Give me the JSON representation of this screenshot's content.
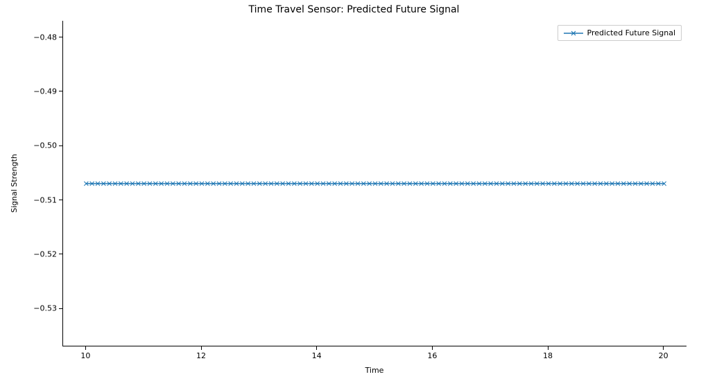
{
  "chart_data": {
    "type": "line",
    "title": "Time Travel Sensor: Predicted Future Signal",
    "xlabel": "Time",
    "ylabel": "Signal Strength",
    "xlim": [
      9.6,
      20.4
    ],
    "ylim": [
      -0.537,
      -0.477
    ],
    "xticks": [
      10,
      12,
      14,
      16,
      18,
      20
    ],
    "yticks": [
      -0.53,
      -0.52,
      -0.51,
      -0.5,
      -0.49,
      -0.48
    ],
    "ytick_labels": [
      "−0.53",
      "−0.52",
      "−0.51",
      "−0.50",
      "−0.49",
      "−0.48"
    ],
    "series": [
      {
        "name": "Predicted Future Signal",
        "color": "#1f77b4",
        "marker": "x",
        "x_start": 10,
        "x_end": 20,
        "n_points": 101,
        "constant_value": -0.507
      }
    ],
    "legend_position": "upper right"
  }
}
